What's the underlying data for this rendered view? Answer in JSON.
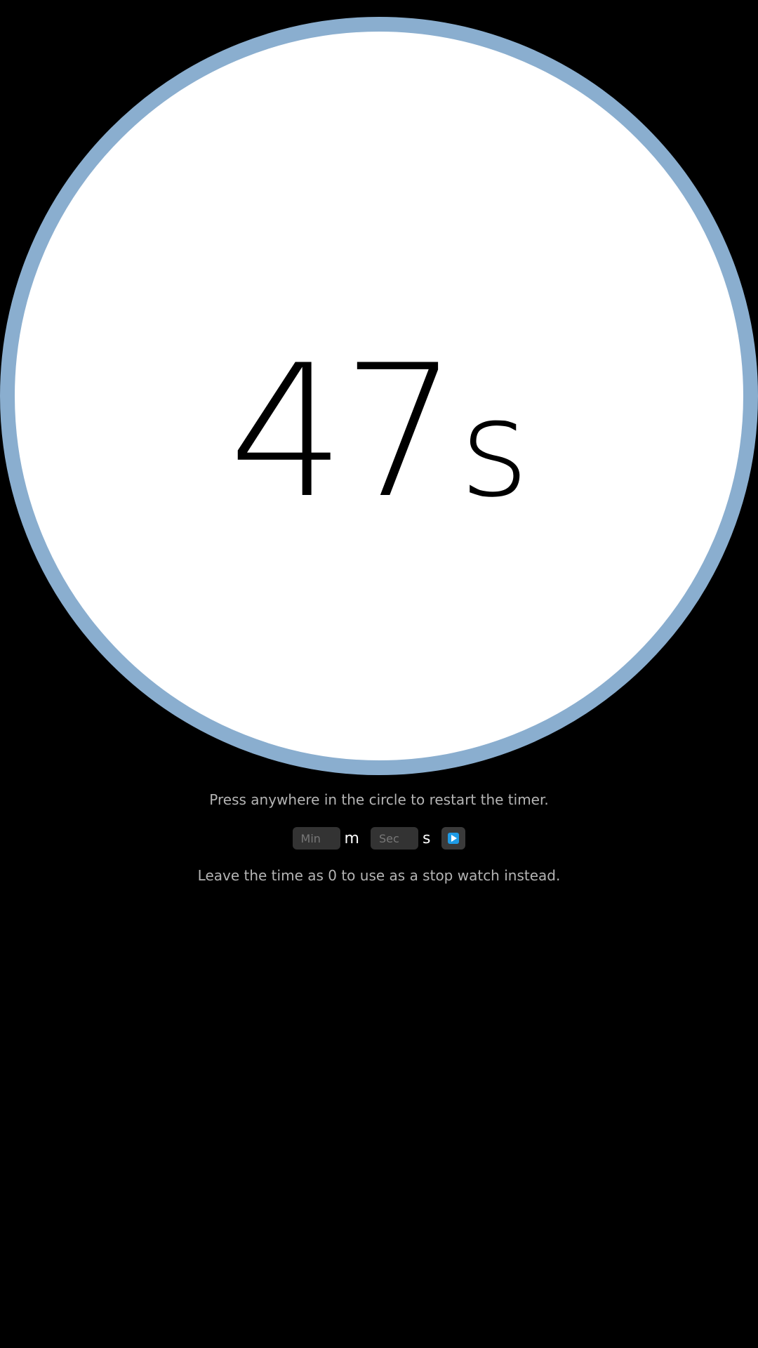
{
  "timer": {
    "value": "47",
    "unit": "s",
    "ring_color": "#8aaecf",
    "face_color": "#ffffff"
  },
  "hints": {
    "restart": "Press anywhere in the circle to restart the timer.",
    "stopwatch": "Leave the time as 0 to use as a stop watch instead."
  },
  "controls": {
    "minutes": {
      "value": "",
      "placeholder": "Min",
      "unit_label": "m"
    },
    "seconds": {
      "value": "",
      "placeholder": "Sec",
      "unit_label": "s"
    },
    "start_button": {
      "icon": "play-icon",
      "icon_color": "#1e9be6"
    }
  }
}
